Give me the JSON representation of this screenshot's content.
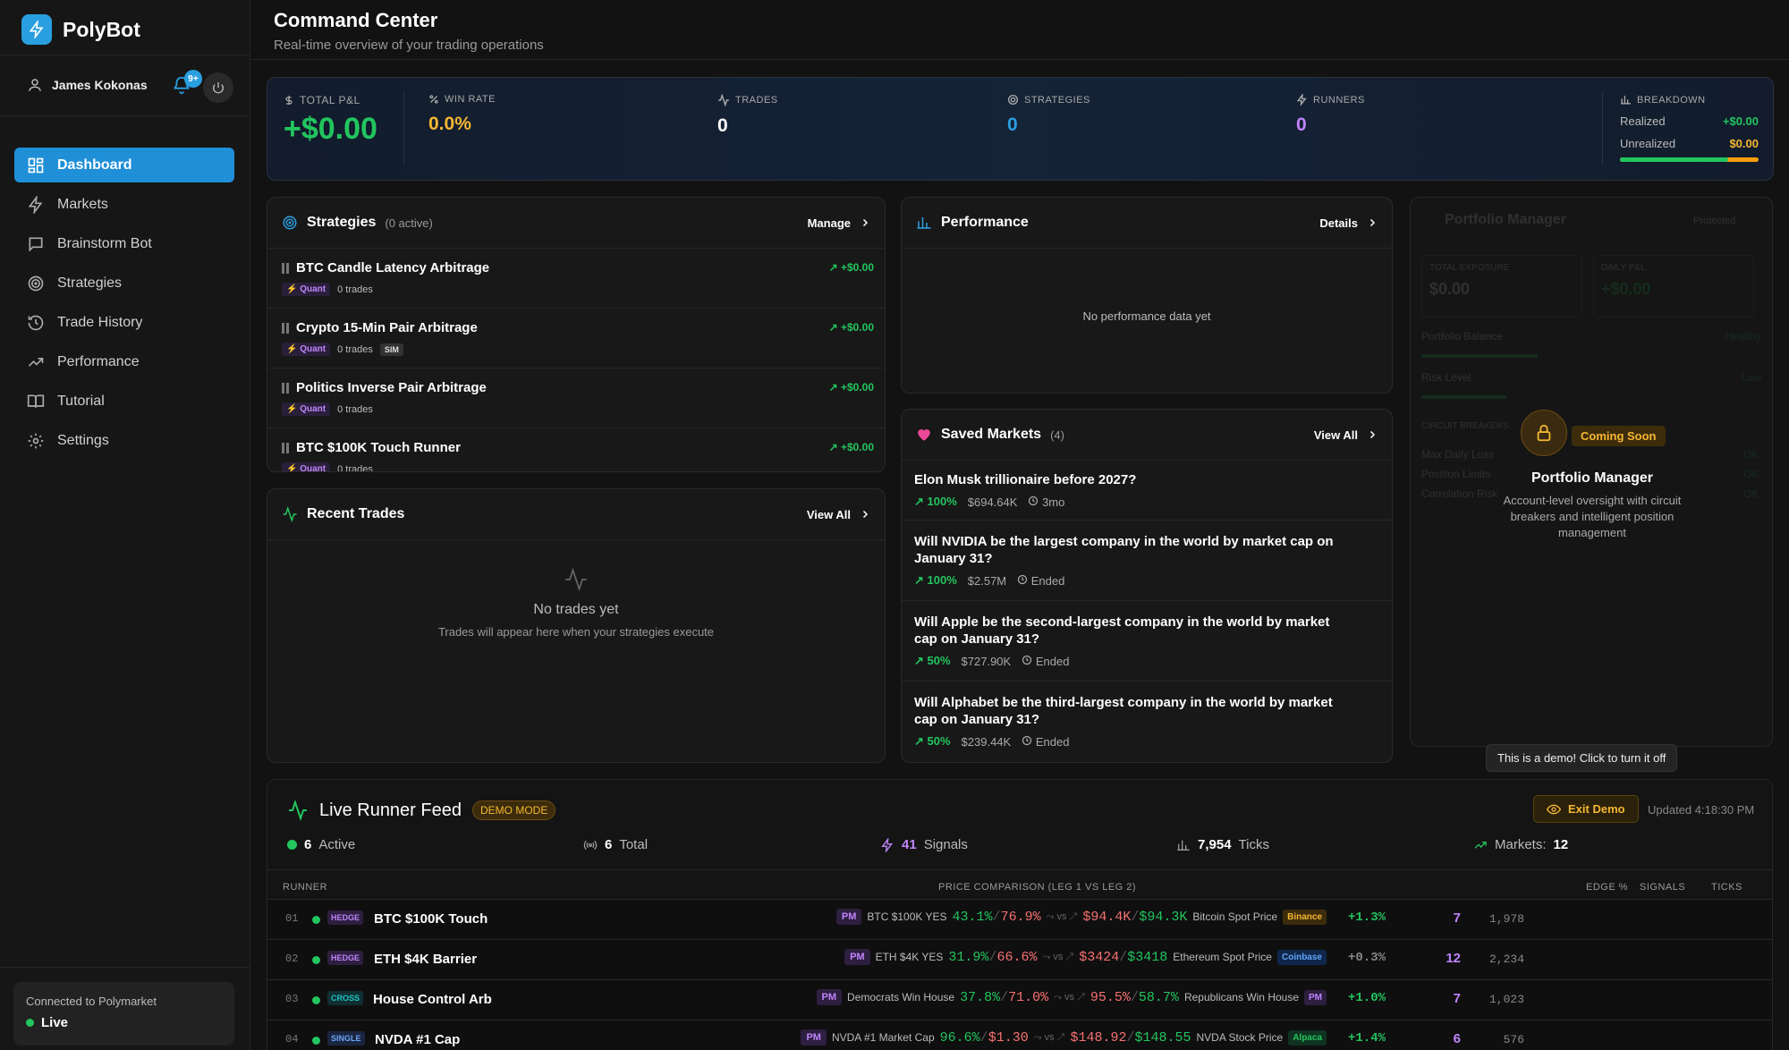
{
  "app": {
    "name": "PolyBot"
  },
  "user": {
    "name": "James Kokonas",
    "notifications": "9+"
  },
  "nav": [
    {
      "label": "Dashboard",
      "icon": "dashboard-icon",
      "active": true
    },
    {
      "label": "Markets",
      "icon": "bolt-icon"
    },
    {
      "label": "Brainstorm Bot",
      "icon": "chat-icon"
    },
    {
      "label": "Strategies",
      "icon": "target-icon"
    },
    {
      "label": "Trade History",
      "icon": "history-icon"
    },
    {
      "label": "Performance",
      "icon": "trending-up-icon"
    },
    {
      "label": "Tutorial",
      "icon": "book-icon"
    },
    {
      "label": "Settings",
      "icon": "gear-icon"
    }
  ],
  "connection": {
    "label": "Connected to Polymarket",
    "status": "Live"
  },
  "header": {
    "title": "Command Center",
    "subtitle": "Real-time overview of your trading operations"
  },
  "stats": {
    "pnl_label": "TOTAL P&L",
    "pnl_value": "+$0.00",
    "winrate_label": "WIN RATE",
    "winrate_value": "0.0%",
    "trades_label": "TRADES",
    "trades_value": "0",
    "strategies_label": "STRATEGIES",
    "strategies_value": "0",
    "runners_label": "RUNNERS",
    "runners_value": "0",
    "breakdown_label": "BREAKDOWN",
    "realized_label": "Realized",
    "realized_value": "+$0.00",
    "unrealized_label": "Unrealized",
    "unrealized_value": "$0.00"
  },
  "strategies": {
    "title": "Strategies",
    "count": "(0 active)",
    "action": "Manage",
    "items": [
      {
        "name": "BTC Candle Latency Arbitrage",
        "pnl": "+$0.00",
        "tag": "Quant",
        "trades": "0 trades",
        "sim": ""
      },
      {
        "name": "Crypto 15-Min Pair Arbitrage",
        "pnl": "+$0.00",
        "tag": "Quant",
        "trades": "0 trades",
        "sim": "SIM"
      },
      {
        "name": "Politics Inverse Pair Arbitrage",
        "pnl": "+$0.00",
        "tag": "Quant",
        "trades": "0 trades",
        "sim": ""
      },
      {
        "name": "BTC $100K Touch Runner",
        "pnl": "+$0.00",
        "tag": "Quant",
        "trades": "0 trades",
        "sim": ""
      }
    ]
  },
  "recent_trades": {
    "title": "Recent Trades",
    "action": "View All",
    "empty_title": "No trades yet",
    "empty_sub": "Trades will appear here when your strategies execute"
  },
  "performance": {
    "title": "Performance",
    "action": "Details",
    "empty": "No performance data yet"
  },
  "saved_markets": {
    "title": "Saved Markets",
    "count": "(4)",
    "action": "View All",
    "items": [
      {
        "title": "Elon Musk trillionaire before 2027?",
        "pct": "100%",
        "vol": "$694.64K",
        "time": "3mo"
      },
      {
        "title": "Will NVIDIA be the largest company in the world by market cap on January 31?",
        "pct": "100%",
        "vol": "$2.57M",
        "time": "Ended"
      },
      {
        "title": "Will Apple be the second-largest company in the world by market cap on January 31?",
        "pct": "50%",
        "vol": "$727.90K",
        "time": "Ended"
      },
      {
        "title": "Will Alphabet be the third-largest company in the world by market cap on January 31?",
        "pct": "50%",
        "vol": "$239.44K",
        "time": "Ended"
      }
    ]
  },
  "portfolio": {
    "ghost_title": "Portfolio Manager",
    "ghost_protected": "Protected",
    "ghost_exposure_label": "TOTAL EXPOSURE",
    "ghost_exposure": "$0.00",
    "ghost_pnl_label": "DAILY P&L",
    "ghost_pnl": "+$0.00",
    "ghost_balance": "Portfolio Balance",
    "ghost_healthy": "Healthy",
    "ghost_risk": "Risk Level",
    "ghost_low": "Low",
    "ghost_breakers": "CIRCUIT BREAKERS",
    "ghost_b1": "Max Daily Loss",
    "ghost_b2": "Position Limits",
    "ghost_b3": "Correlation Risk",
    "ghost_ok": "OK",
    "badge": "Coming Soon",
    "title": "Portfolio Manager",
    "desc": "Account-level oversight with circuit breakers and intelligent position management"
  },
  "tooltip": "This is a demo! Click to turn it off",
  "feed": {
    "title": "Live Runner Feed",
    "badge": "DEMO MODE",
    "exit": "Exit Demo",
    "updated": "Updated 4:18:30 PM",
    "active_n": "6",
    "active_l": "Active",
    "total_n": "6",
    "total_l": "Total",
    "signals_n": "41",
    "signals_l": "Signals",
    "ticks_n": "7,954",
    "ticks_l": "Ticks",
    "markets_l": "Markets:",
    "markets_n": "12",
    "headers": {
      "runner": "RUNNER",
      "price": "PRICE COMPARISON (LEG 1 VS LEG 2)",
      "edge": "EDGE %",
      "signals": "SIGNALS",
      "ticks": "TICKS"
    },
    "rows": [
      {
        "num": "01",
        "type": "HEDGE",
        "name": "BTC $100K Touch",
        "leg1_src": "PM",
        "leg1_label": "BTC $100K YES",
        "leg1_a": "43.1%",
        "leg1_b": "76.9%",
        "vs": "vs",
        "leg2_a": "$94.4K",
        "leg2_b": "$94.3K",
        "leg2_label": "Bitcoin Spot Price",
        "leg2_src": "Binance",
        "edge": "+1.3%",
        "signals": "7",
        "ticks": "1,978"
      },
      {
        "num": "02",
        "type": "HEDGE",
        "name": "ETH $4K Barrier",
        "leg1_src": "PM",
        "leg1_label": "ETH $4K YES",
        "leg1_a": "31.9%",
        "leg1_b": "66.6%",
        "vs": "vs",
        "leg2_a": "$3424",
        "leg2_b": "$3418",
        "leg2_label": "Ethereum Spot Price",
        "leg2_src": "Coinbase",
        "edge": "+0.3%",
        "signals": "12",
        "ticks": "2,234"
      },
      {
        "num": "03",
        "type": "CROSS",
        "name": "House Control Arb",
        "leg1_src": "PM",
        "leg1_label": "Democrats Win House",
        "leg1_a": "37.8%",
        "leg1_b": "71.0%",
        "vs": "vs",
        "leg2_a": "95.5%",
        "leg2_b": "58.7%",
        "leg2_label": "Republicans Win House",
        "leg2_src": "PM",
        "edge": "+1.0%",
        "signals": "7",
        "ticks": "1,023"
      },
      {
        "num": "04",
        "type": "SINGLE",
        "name": "NVDA #1 Cap",
        "leg1_src": "PM",
        "leg1_label": "NVDA #1 Market Cap",
        "leg1_a": "96.6%",
        "leg1_b": "$1.30",
        "vs": "vs",
        "leg2_a": "$148.92",
        "leg2_b": "$148.55",
        "leg2_label": "NVDA Stock Price",
        "leg2_src": "Alpaca",
        "edge": "+1.4%",
        "signals": "6",
        "ticks": "576"
      }
    ]
  }
}
